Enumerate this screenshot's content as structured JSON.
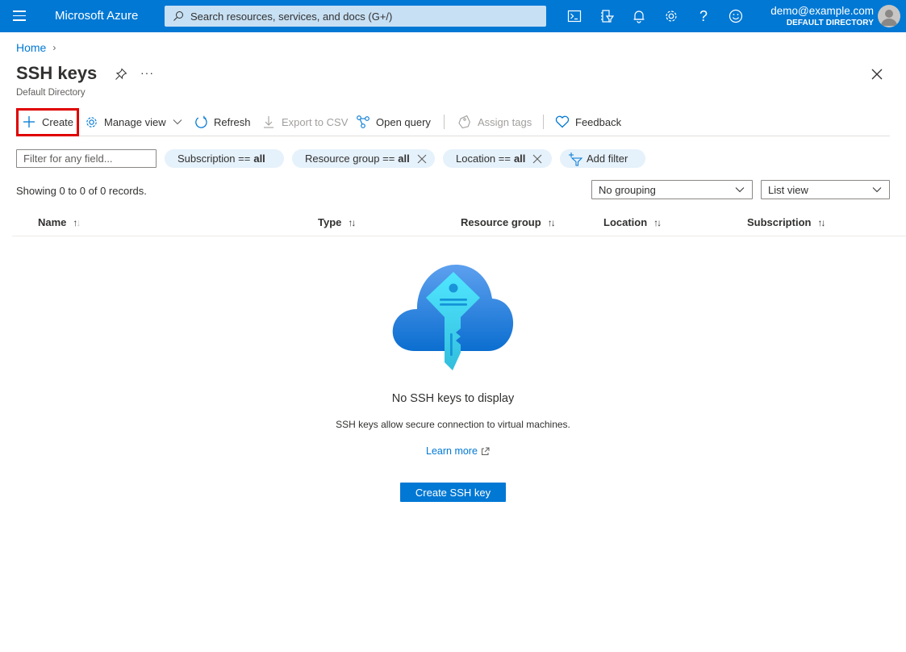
{
  "topbar": {
    "brand": "Microsoft Azure",
    "search_placeholder": "Search resources, services, and docs (G+/)",
    "icons": [
      "cloud-shell-icon",
      "directory-filter-icon",
      "notifications-icon",
      "settings-icon",
      "help-icon",
      "feedback-smiley-icon"
    ],
    "user_email": "demo@example.com",
    "user_directory": "DEFAULT DIRECTORY",
    "accent": "#0078d4"
  },
  "breadcrumb": {
    "items": [
      "Home"
    ]
  },
  "header": {
    "title": "SSH keys",
    "subtitle": "Default Directory",
    "more_label": "···"
  },
  "toolbar": {
    "create": "Create",
    "manage_view": "Manage view",
    "refresh": "Refresh",
    "export_csv": "Export to CSV",
    "open_query": "Open query",
    "assign_tags": "Assign tags",
    "feedback": "Feedback",
    "highlight_color": "#e00000"
  },
  "filters": {
    "search_placeholder": "Filter for any field...",
    "pills": [
      {
        "label": "Subscription ==",
        "value": "all",
        "removable": false
      },
      {
        "label": "Resource group ==",
        "value": "all",
        "removable": true
      },
      {
        "label": "Location ==",
        "value": "all",
        "removable": true
      }
    ],
    "add_filter": "Add filter"
  },
  "list": {
    "records_text": "Showing 0 to 0 of 0 records.",
    "grouping": "No grouping",
    "view": "List view",
    "columns": [
      "Name",
      "Type",
      "Resource group",
      "Location",
      "Subscription"
    ]
  },
  "empty_state": {
    "title": "No SSH keys to display",
    "description": "SSH keys allow secure connection to virtual machines.",
    "learn_more": "Learn more",
    "button": "Create SSH key"
  }
}
